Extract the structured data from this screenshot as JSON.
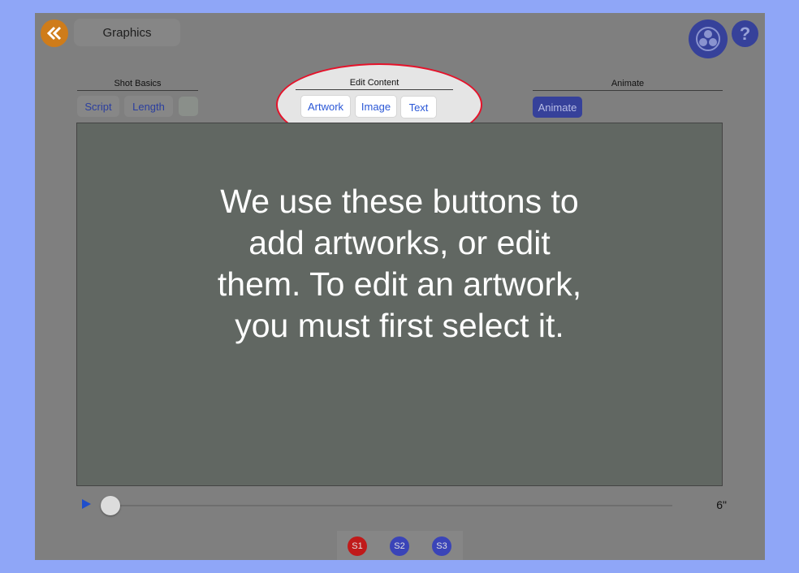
{
  "header": {
    "title": "Graphics",
    "back_icon": "chevrons-left-icon",
    "share_icon": "team-icon",
    "help_label": "?"
  },
  "shot_basics": {
    "label": "Shot Basics",
    "buttons": [
      "Script",
      "Length"
    ]
  },
  "edit_content": {
    "label": "Edit Content",
    "buttons": [
      "Artwork",
      "Image",
      "Text"
    ]
  },
  "animate": {
    "label": "Animate",
    "button": "Animate"
  },
  "stage": {
    "overlay_text_lines": [
      "We use these buttons to",
      "add artworks, or edit",
      "them. To edit an artwork,",
      "you must first select it."
    ]
  },
  "timeline": {
    "duration": "6\"",
    "position": 0
  },
  "scenes": [
    "S1",
    "S2",
    "S3"
  ],
  "colors": {
    "accent_orange": "#cf7c1a",
    "accent_blue": "#36419a",
    "highlight_red": "#e5122a",
    "scene_active": "#c01a1a",
    "scene_inactive": "#3a44b8"
  }
}
